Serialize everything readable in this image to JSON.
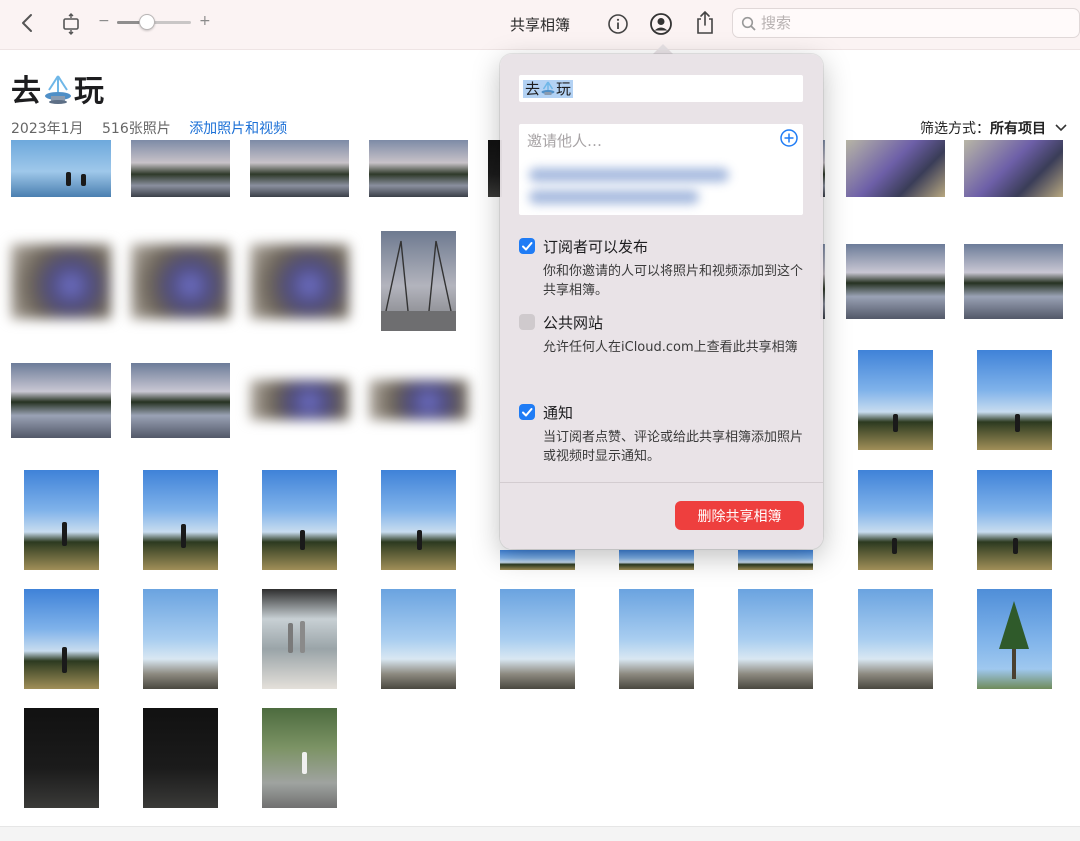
{
  "toolbar": {
    "zoom_minus": "−",
    "zoom_plus": "+",
    "zoom_level": 0.4,
    "share_title": "共享相簿",
    "search_placeholder": "搜索"
  },
  "album": {
    "title_part1": "去",
    "title_part2": "玩",
    "date": "2023年1月",
    "count": "516张照片",
    "add_link": "添加照片和视频",
    "filter_label": "筛选方式：",
    "filter_value": "所有项目"
  },
  "popover": {
    "album_name_part1": "去",
    "album_name_part2": "玩",
    "invite_placeholder": "邀请他人…",
    "options": [
      {
        "label": "订阅者可以发布",
        "desc": "你和你邀请的人可以将照片和视频添加到这个共享相簿。",
        "checked": true
      },
      {
        "label": "公共网站",
        "desc": "允许任何人在iCloud.com上查看此共享相簿",
        "checked": false
      },
      {
        "label": "通知",
        "desc": "当订阅者点赞、评论或给此共享相簿添加照片或视频时显示通知。",
        "checked": true
      }
    ],
    "delete_label": "删除共享相簿"
  },
  "colors": {
    "accent": "#1f7cf5",
    "link": "#1a6fd6",
    "destructive": "#ee3f3e",
    "toolbar_bg": "#fbf3f3"
  }
}
